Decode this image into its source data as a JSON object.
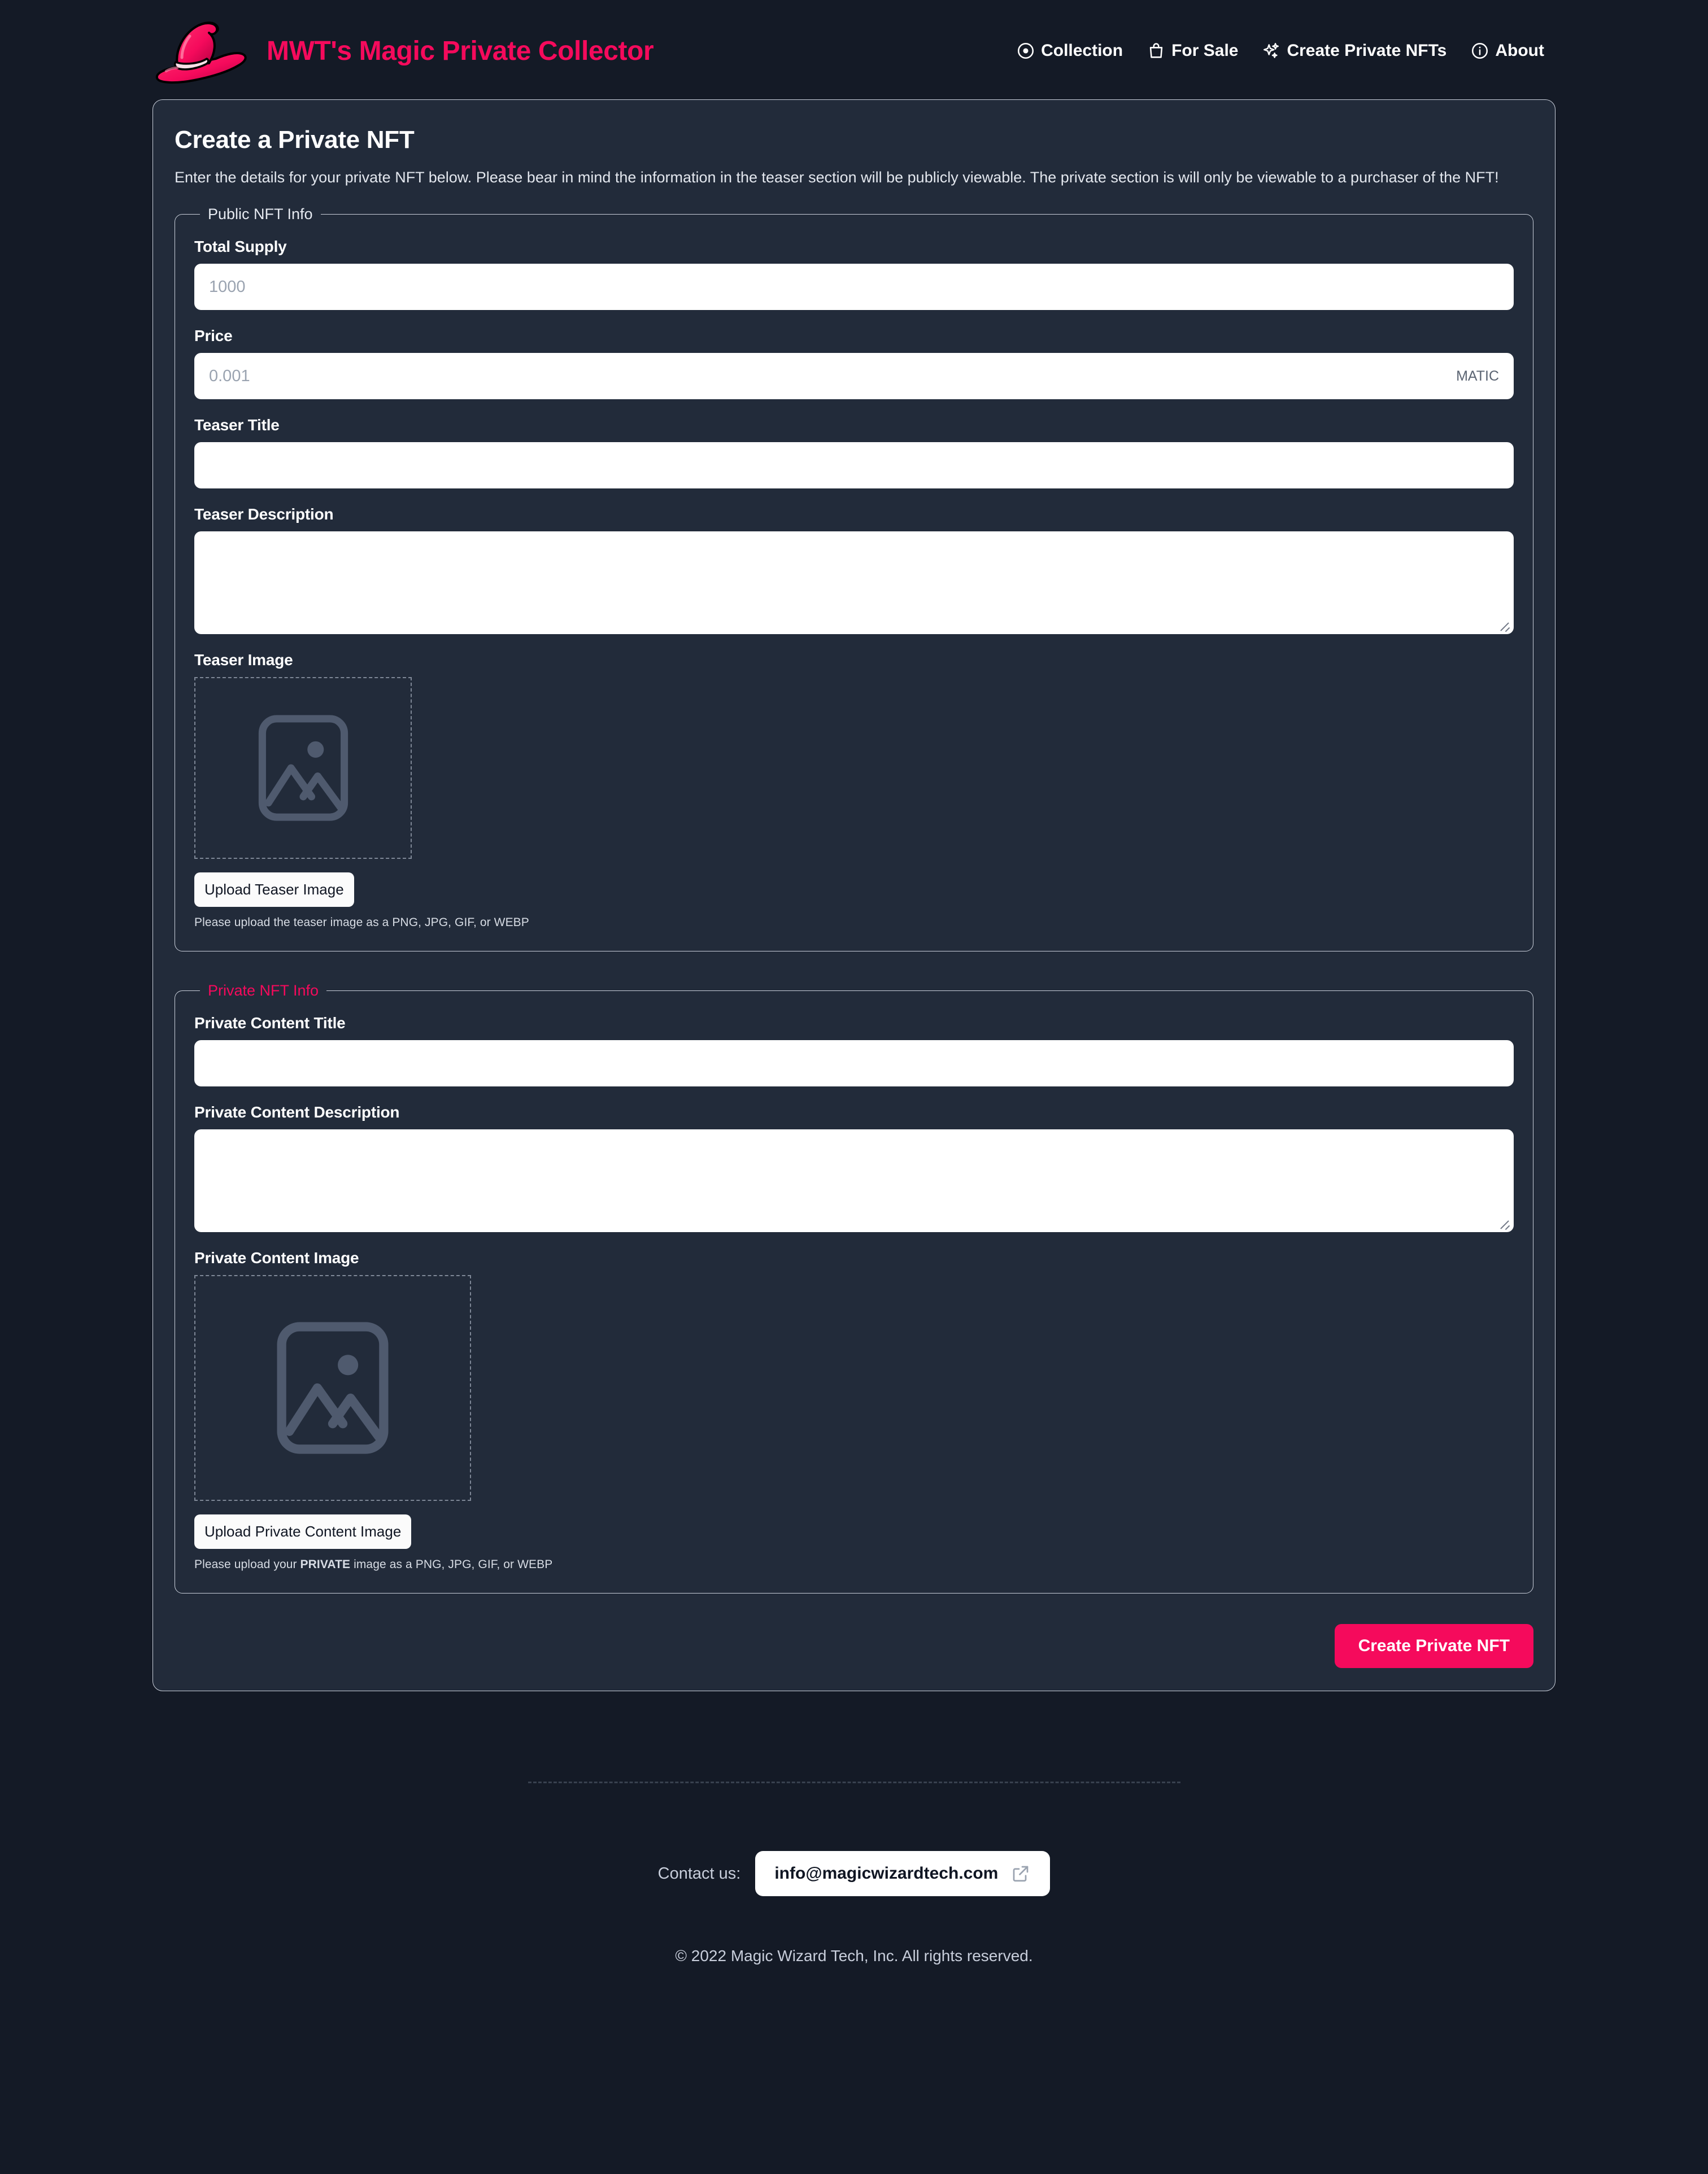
{
  "brand": {
    "title": "MWT's Magic Private Collector",
    "logo_icon": "wizard-hat-icon",
    "brand_color": "#f50a5c"
  },
  "nav": {
    "items": [
      {
        "label": "Collection",
        "icon": "target-eye-icon"
      },
      {
        "label": "For Sale",
        "icon": "shopping-bag-icon"
      },
      {
        "label": "Create Private NFTs",
        "icon": "sparkles-icon"
      },
      {
        "label": "About",
        "icon": "info-circle-icon"
      }
    ]
  },
  "card": {
    "title": "Create a Private NFT",
    "description": "Enter the details for your private NFT below. Please bear in mind the information in the teaser section will be publicly viewable. The private section is will only be viewable to a purchaser of the NFT!"
  },
  "public_section": {
    "legend": "Public NFT Info",
    "total_supply": {
      "label": "Total Supply",
      "value": "",
      "placeholder": "1000"
    },
    "price": {
      "label": "Price",
      "value": "",
      "placeholder": "0.001",
      "suffix": "MATIC"
    },
    "teaser_title": {
      "label": "Teaser Title",
      "value": "",
      "placeholder": ""
    },
    "teaser_description": {
      "label": "Teaser Description",
      "value": "",
      "placeholder": ""
    },
    "teaser_image": {
      "label": "Teaser Image",
      "upload_button": "Upload Teaser Image",
      "help_text": "Please upload the teaser image as a PNG, JPG, GIF, or WEBP",
      "placeholder_icon": "image-placeholder-icon"
    }
  },
  "private_section": {
    "legend": "Private NFT Info",
    "legend_color": "#f50a5c",
    "private_title": {
      "label": "Private Content Title",
      "value": "",
      "placeholder": ""
    },
    "private_description": {
      "label": "Private Content Description",
      "value": "",
      "placeholder": ""
    },
    "private_image": {
      "label": "Private Content Image",
      "upload_button": "Upload Private Content Image",
      "help_prefix": "Please upload your ",
      "help_emphasis": "PRIVATE",
      "help_suffix": " image as a PNG, JPG, GIF, or WEBP",
      "placeholder_icon": "image-placeholder-icon"
    }
  },
  "submit": {
    "label": "Create Private NFT",
    "color": "#f50a5c"
  },
  "footer": {
    "contact_label": "Contact us:",
    "email": "info@magicwizardtech.com",
    "external_icon": "external-link-icon",
    "copyright": "© 2022 Magic Wizard Tech, Inc. All rights reserved."
  },
  "theme": {
    "page_bg": "#141a26",
    "card_bg": "#222b3a",
    "accent": "#f50a5c"
  }
}
